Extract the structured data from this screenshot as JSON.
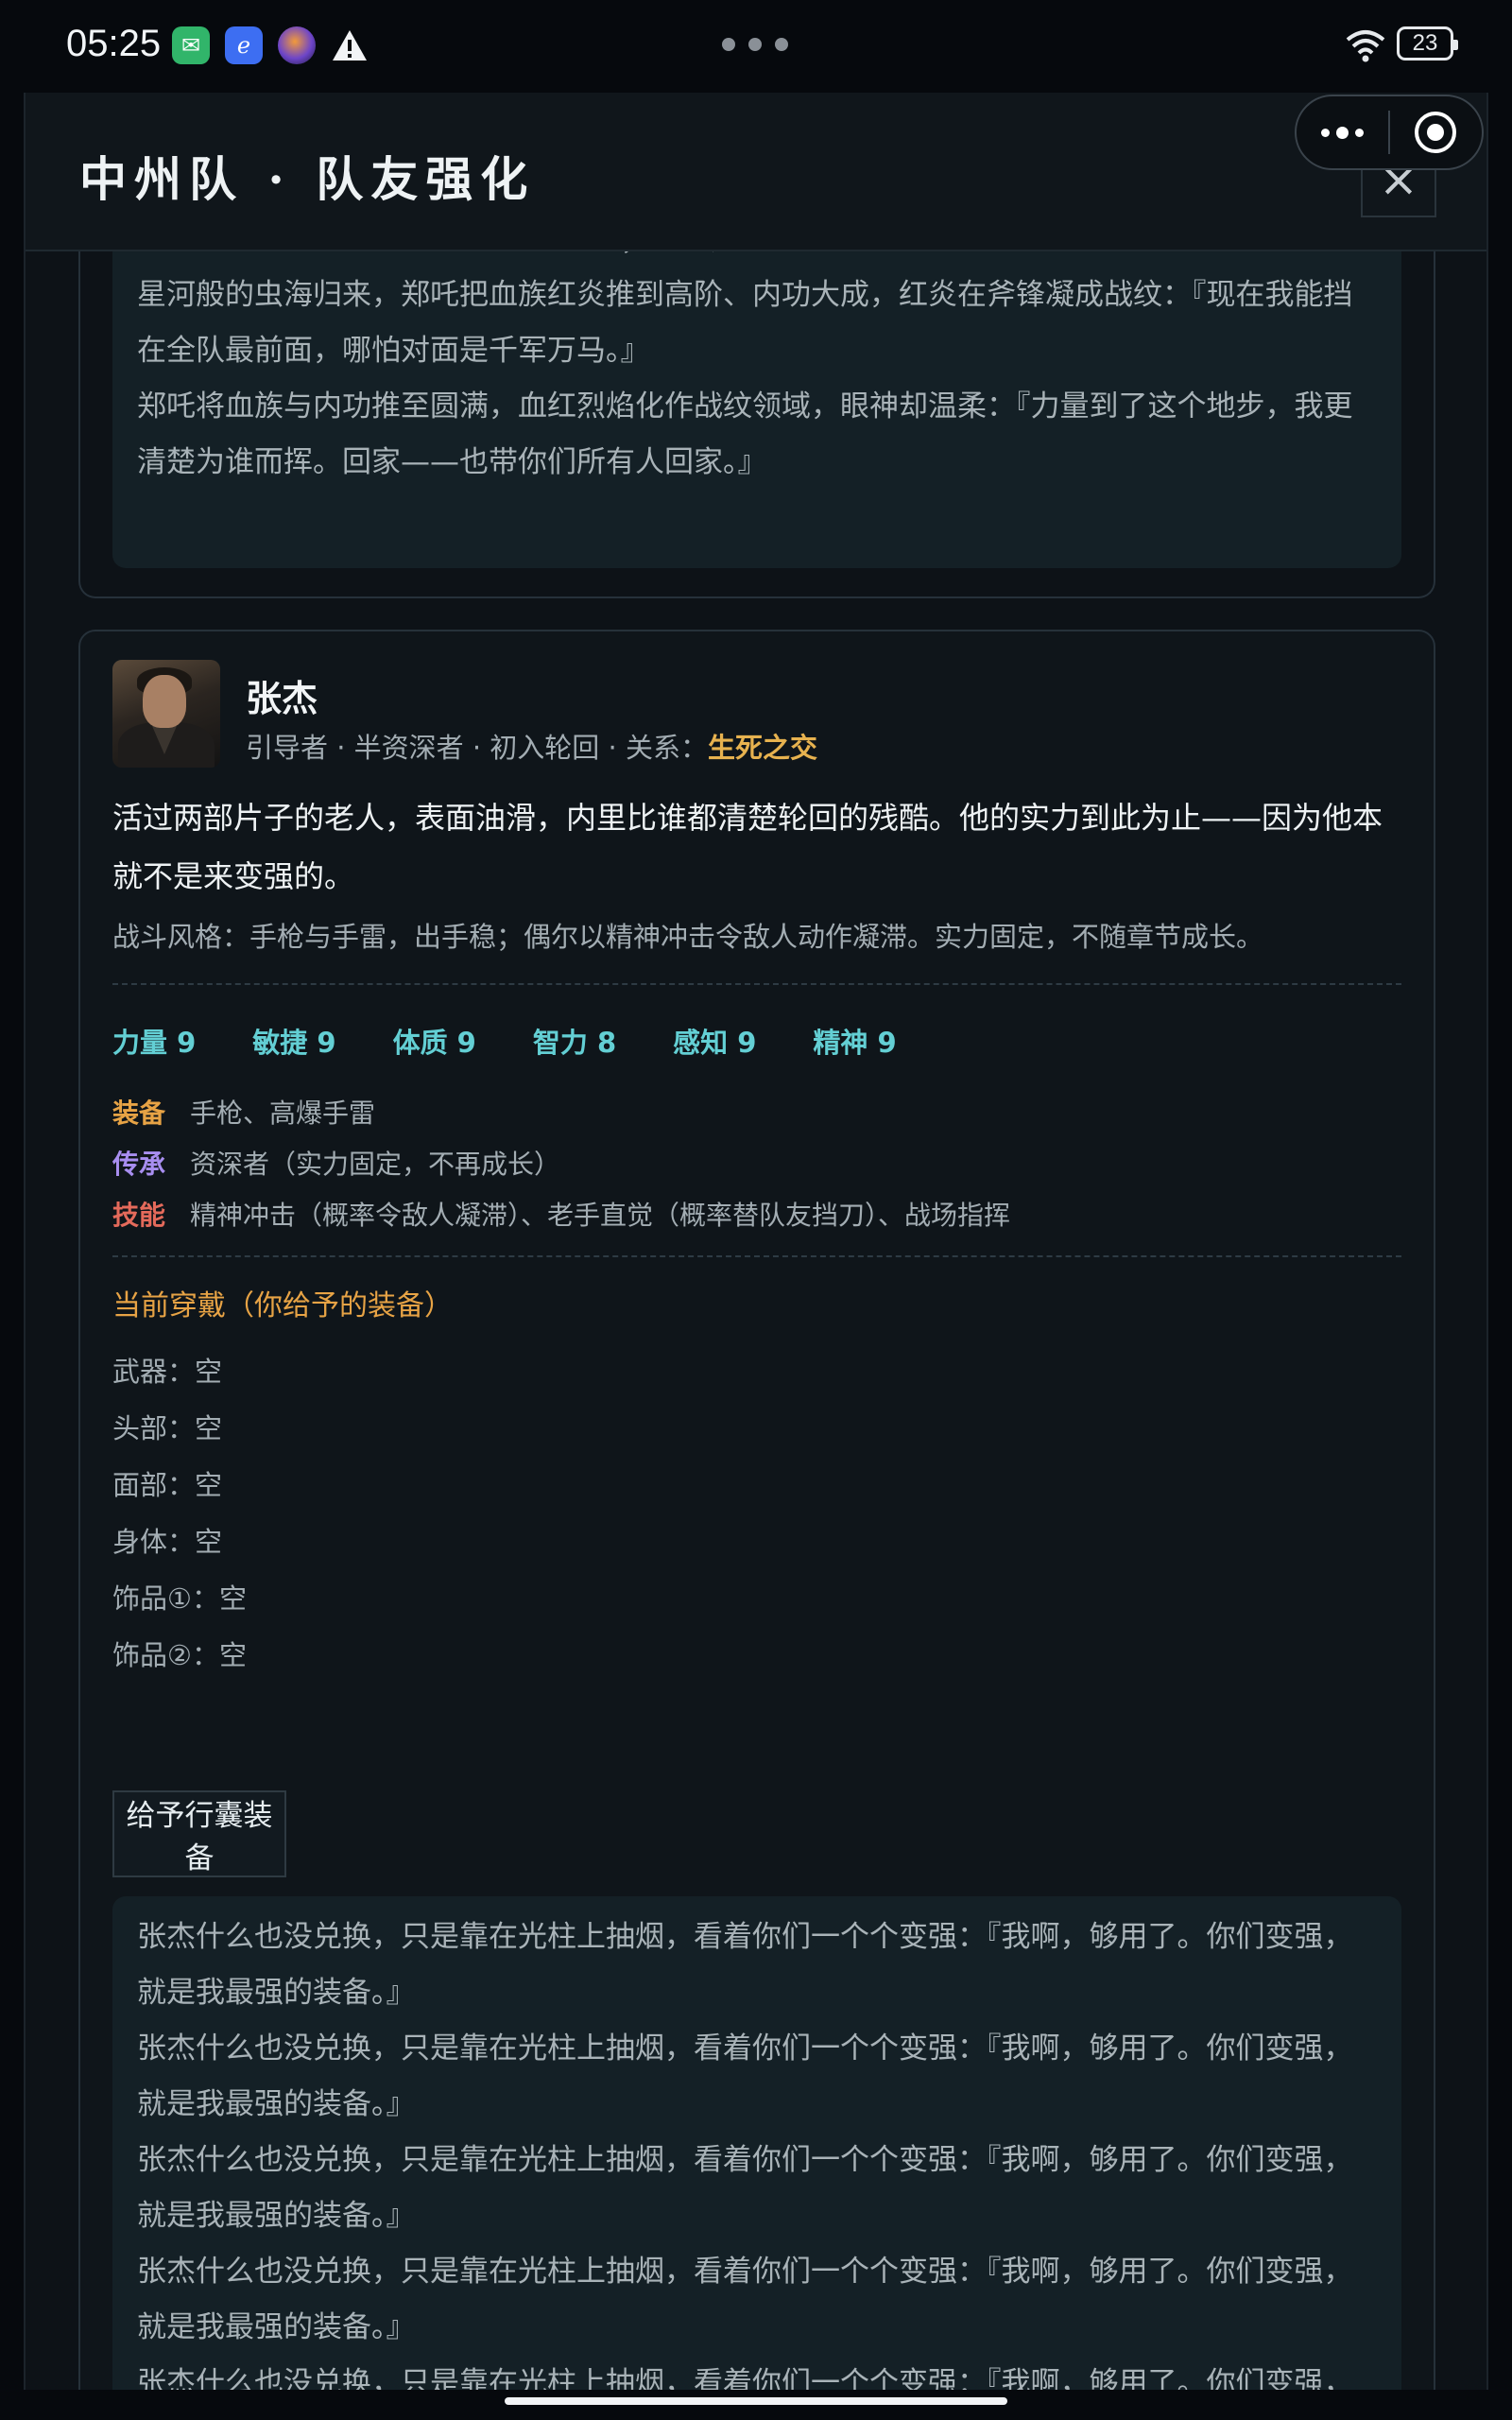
{
  "status_bar": {
    "time": "05:25",
    "battery": "23",
    "icons": [
      "mail-app-icon",
      "browser-app-icon",
      "orb-app-icon",
      "warning-icon"
    ]
  },
  "header": {
    "title": "中州队 · 队友强化",
    "close_glyph": "×"
  },
  "card_prev": {
    "story": [
      "烫的手掌：『以前我是为了一个人变强；现在，我想护住你们所有人。』",
      "星河般的虫海归来，郑吒把血族红炎推到高阶、内功大成，红炎在斧锋凝成战纹：『现在我能挡在全队最前面，哪怕对面是千军万马。』",
      "郑吒将血族与内功推至圆满，血红烈焰化作战纹领域，眼神却温柔：『力量到了这个地步，我更清楚为谁而挥。回家——也带你们所有人回家。』"
    ]
  },
  "card_zhangjie": {
    "name": "张杰",
    "meta_prefix": "引导者 · 半资深者 · 初入轮回 · 关系：",
    "relation": "生死之交",
    "description": "活过两部片子的老人，表面油滑，内里比谁都清楚轮回的残酷。他的实力到此为止——因为他本就不是来变强的。",
    "combat_style": "战斗风格：手枪与手雷，出手稳；偶尔以精神冲击令敌人动作凝滞。实力固定，不随章节成长。",
    "stats": [
      "力量 9",
      "敏捷 9",
      "体质 9",
      "智力 8",
      "感知 9",
      "精神 9"
    ],
    "equipment_label": "装备",
    "equipment": "手枪、高爆手雷",
    "inheritance_label": "传承",
    "inheritance": "资深者（实力固定，不再成长）",
    "skills_label": "技能",
    "skills": "精神冲击（概率令敌人凝滞）、老手直觉（概率替队友挡刀）、战场指挥",
    "wearing_title": "当前穿戴（你给予的装备）",
    "slots": [
      "武器：空",
      "头部：空",
      "面部：空",
      "身体：空",
      "饰品①：空",
      "饰品②：空"
    ],
    "give_button": "给予行囊装备",
    "story": [
      "张杰什么也没兑换，只是靠在光柱上抽烟，看着你们一个个变强：『我啊，够用了。你们变强，就是我最强的装备。』",
      "张杰什么也没兑换，只是靠在光柱上抽烟，看着你们一个个变强：『我啊，够用了。你们变强，就是我最强的装备。』",
      "张杰什么也没兑换，只是靠在光柱上抽烟，看着你们一个个变强：『我啊，够用了。你们变强，就是我最强的装备。』",
      "张杰什么也没兑换，只是靠在光柱上抽烟，看着你们一个个变强：『我啊，够用了。你们变强，就是我最强的装备。』",
      "张杰什么也没兑换，只是靠在光柱上抽烟，看着你们一个个变强：『我啊，够用了。你们变强，就是我最强的装备。』"
    ]
  }
}
